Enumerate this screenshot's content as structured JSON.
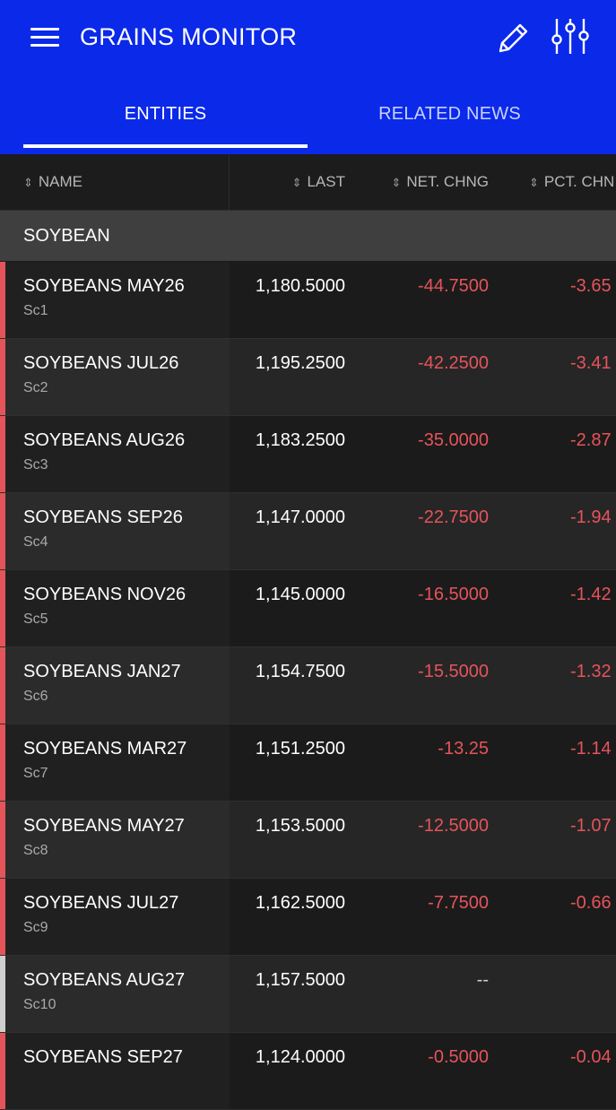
{
  "app": {
    "title": "GRAINS MONITOR",
    "icons": [
      "menu-icon",
      "edit-icon",
      "filter-sliders-icon"
    ]
  },
  "tabs": [
    {
      "label": "ENTITIES",
      "active": true
    },
    {
      "label": "RELATED NEWS",
      "active": false
    }
  ],
  "columns": {
    "name": "NAME",
    "last": "LAST",
    "net_chng": "NET. CHNG",
    "pct_chng": "PCT. CHN"
  },
  "group": "SOYBEAN",
  "colors": {
    "brand_blue": "#0a29e8",
    "negative": "#e5545a",
    "neutral": "#cfcfcf"
  },
  "rows": [
    {
      "name": "SOYBEANS MAY26",
      "ric": "Sc1",
      "last": "1,180.5000",
      "net": "-44.7500",
      "pct": "-3.65",
      "dir": "down"
    },
    {
      "name": "SOYBEANS JUL26",
      "ric": "Sc2",
      "last": "1,195.2500",
      "net": "-42.2500",
      "pct": "-3.41",
      "dir": "down"
    },
    {
      "name": "SOYBEANS AUG26",
      "ric": "Sc3",
      "last": "1,183.2500",
      "net": "-35.0000",
      "pct": "-2.87",
      "dir": "down"
    },
    {
      "name": "SOYBEANS SEP26",
      "ric": "Sc4",
      "last": "1,147.0000",
      "net": "-22.7500",
      "pct": "-1.94",
      "dir": "down"
    },
    {
      "name": "SOYBEANS NOV26",
      "ric": "Sc5",
      "last": "1,145.0000",
      "net": "-16.5000",
      "pct": "-1.42",
      "dir": "down"
    },
    {
      "name": "SOYBEANS JAN27",
      "ric": "Sc6",
      "last": "1,154.7500",
      "net": "-15.5000",
      "pct": "-1.32",
      "dir": "down"
    },
    {
      "name": "SOYBEANS MAR27",
      "ric": "Sc7",
      "last": "1,151.2500",
      "net": "-13.25",
      "pct": "-1.14",
      "dir": "down"
    },
    {
      "name": "SOYBEANS MAY27",
      "ric": "Sc8",
      "last": "1,153.5000",
      "net": "-12.5000",
      "pct": "-1.07",
      "dir": "down"
    },
    {
      "name": "SOYBEANS JUL27",
      "ric": "Sc9",
      "last": "1,162.5000",
      "net": "-7.7500",
      "pct": "-0.66",
      "dir": "down"
    },
    {
      "name": "SOYBEANS AUG27",
      "ric": "Sc10",
      "last": "1,157.5000",
      "net": "--",
      "pct": "",
      "dir": "flat"
    },
    {
      "name": "SOYBEANS SEP27",
      "ric": "",
      "last": "1,124.0000",
      "net": "-0.5000",
      "pct": "-0.04",
      "dir": "down"
    }
  ]
}
